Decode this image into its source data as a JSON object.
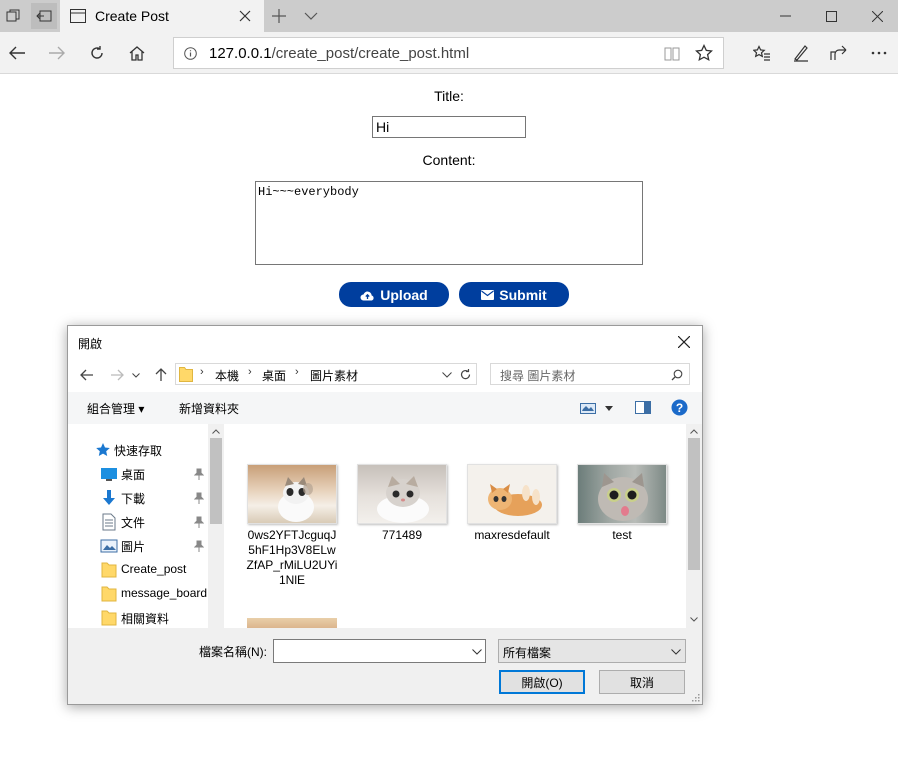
{
  "browser": {
    "tab_title": "Create Post",
    "url_host": "127.0.0.1",
    "url_path": "/create_post/create_post.html"
  },
  "form": {
    "title_label": "Title:",
    "title_value": "Hi",
    "content_label": "Content:",
    "content_value": "Hi~~~everybody",
    "upload_label": "Upload",
    "submit_label": "Submit",
    "button_color": "#003e9e"
  },
  "dialog": {
    "title": "開啟",
    "breadcrumb": [
      "本機",
      "桌面",
      "圖片素材"
    ],
    "search_placeholder": "搜尋 圖片素材",
    "organize_label": "組合管理",
    "new_folder_label": "新增資料夾",
    "nav_items": [
      {
        "label": "快速存取",
        "icon": "star-icon"
      },
      {
        "label": "桌面",
        "icon": "desktop-icon",
        "pinned": true
      },
      {
        "label": "下載",
        "icon": "download-icon",
        "pinned": true
      },
      {
        "label": "文件",
        "icon": "document-icon",
        "pinned": true
      },
      {
        "label": "圖片",
        "icon": "pictures-icon",
        "pinned": true
      },
      {
        "label": "Create_post",
        "icon": "folder-icon"
      },
      {
        "label": "message_board",
        "icon": "folder-icon"
      },
      {
        "label": "相關資料",
        "icon": "folder-icon"
      }
    ],
    "files": [
      {
        "name": "0ws2YFTJcguqJ5hF1Hp3V8ELwZfAP_rMiLU2UYi1NlE",
        "display_lines": [
          "0ws2YFTJcguqJ",
          "5hF1Hp3V8ELw",
          "ZfAP_rMiLU2UYi",
          "1NlE"
        ]
      },
      {
        "name": "771489",
        "display_lines": [
          "771489"
        ]
      },
      {
        "name": "maxresdefault",
        "display_lines": [
          "maxresdefault"
        ]
      },
      {
        "name": "test",
        "display_lines": [
          "test"
        ]
      }
    ],
    "filename_label": "檔案名稱(N):",
    "filename_value": "",
    "filetype_value": "所有檔案",
    "open_label": "開啟(O)",
    "cancel_label": "取消"
  }
}
